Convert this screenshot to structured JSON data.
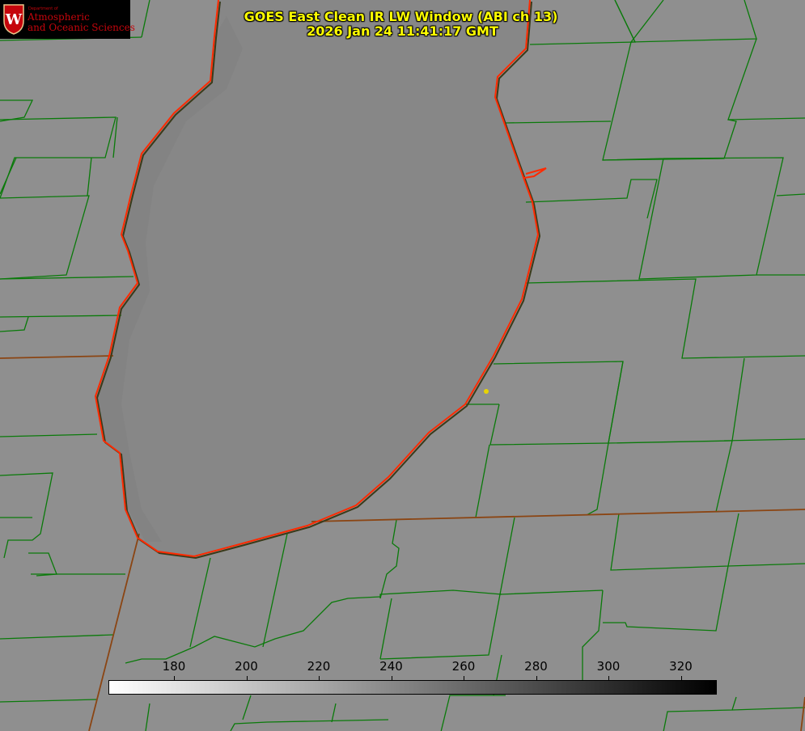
{
  "title": {
    "line1": "GOES East Clean IR LW Window (ABI ch 13)",
    "line2": "2026 Jan 24 11:41:17 GMT"
  },
  "logo": {
    "department_line": "Department of",
    "line1": "Atmospheric",
    "line2": "and Oceanic Sciences",
    "crest_letter": "W"
  },
  "colorbar": {
    "ticks": [
      "180",
      "200",
      "220",
      "240",
      "260",
      "280",
      "300",
      "320"
    ],
    "tick_values": [
      180,
      200,
      220,
      240,
      260,
      280,
      300,
      320
    ],
    "gradient_start": "#ffffff",
    "gradient_end": "#000000"
  },
  "colors": {
    "background_gray": "#8f8f8f",
    "lake_gray": "#878787",
    "county_lines": "#0a7a0a",
    "state_lines": "#8b4513",
    "shoreline": "#ff2a00",
    "title_text": "#ffff00",
    "logo_text": "#c5050c",
    "marker": "#e8d400"
  }
}
